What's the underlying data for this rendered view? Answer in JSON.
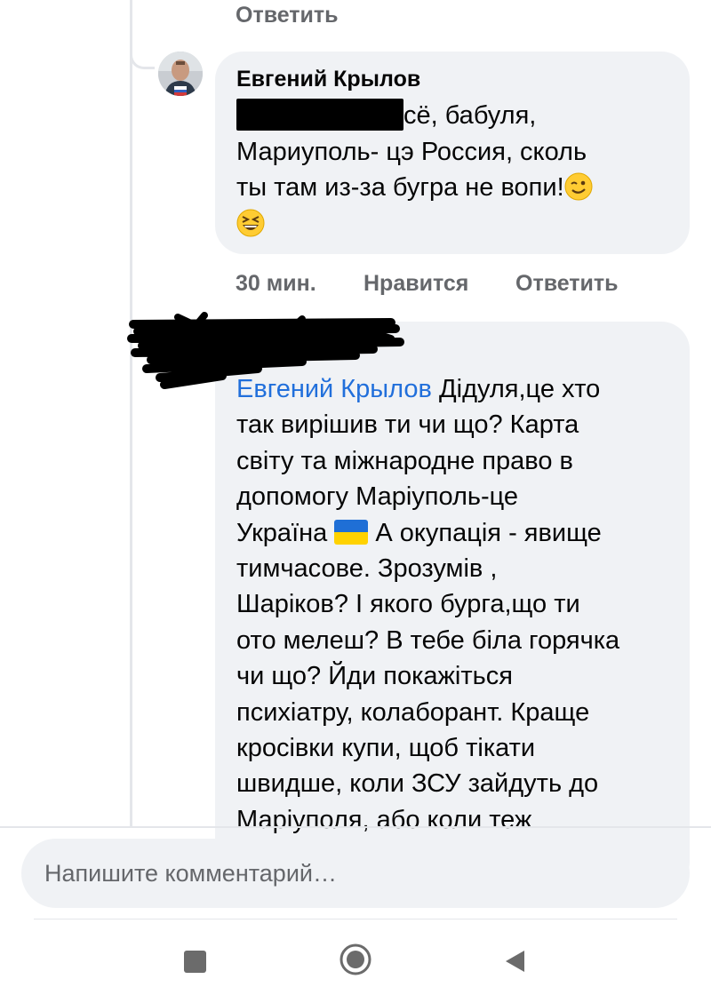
{
  "top_reply": {
    "reply_label": "Ответить"
  },
  "comment_1": {
    "author": "Евгений Крылов",
    "text_line_1_visible": "сё, бабуля,",
    "text_line_2": "Мариуполь- цэ Россия, сколь",
    "text_line_3": "ты там из-за бугра не вопи!",
    "emoji_1": "winking-face-emoji",
    "emoji_2": "grinning-squinting-face-emoji",
    "time": "30 мин.",
    "like_label": "Нравится",
    "reply_label": "Ответить"
  },
  "comment_2": {
    "mention": "Евгений Крылов",
    "text_after_mention": " Дідуля,це хто",
    "lines": [
      "так вирішив ти   чи що? Карта",
      "світу та міжнародне право в",
      "допомогу Маріуполь-це"
    ],
    "line_with_flag_before": "Україна ",
    "flag": "ukraine-flag-emoji",
    "line_with_flag_after": " А окупація - явище",
    "lines_2": [
      "тимчасове. Зрозумів ,",
      "Шаріков? І якого бурга,що ти",
      "ото мелеш? В тебе біла горячка",
      "чи що? Йди покажіться",
      "психіатру, колаборант. Краще",
      "кросівки купи, щоб тікати",
      "швидше, коли ЗСУ зайдуть до",
      "Маріуполя, або коли теж"
    ]
  },
  "composer": {
    "placeholder": "Напишите комментарий…"
  },
  "system_nav": {
    "buttons": [
      "recents-button",
      "home-button",
      "back-button"
    ]
  },
  "colors": {
    "bubble_bg": "#f0f2f5",
    "mention_blue": "#216fdb",
    "secondary_text": "#65676b",
    "primary_text": "#050505"
  }
}
